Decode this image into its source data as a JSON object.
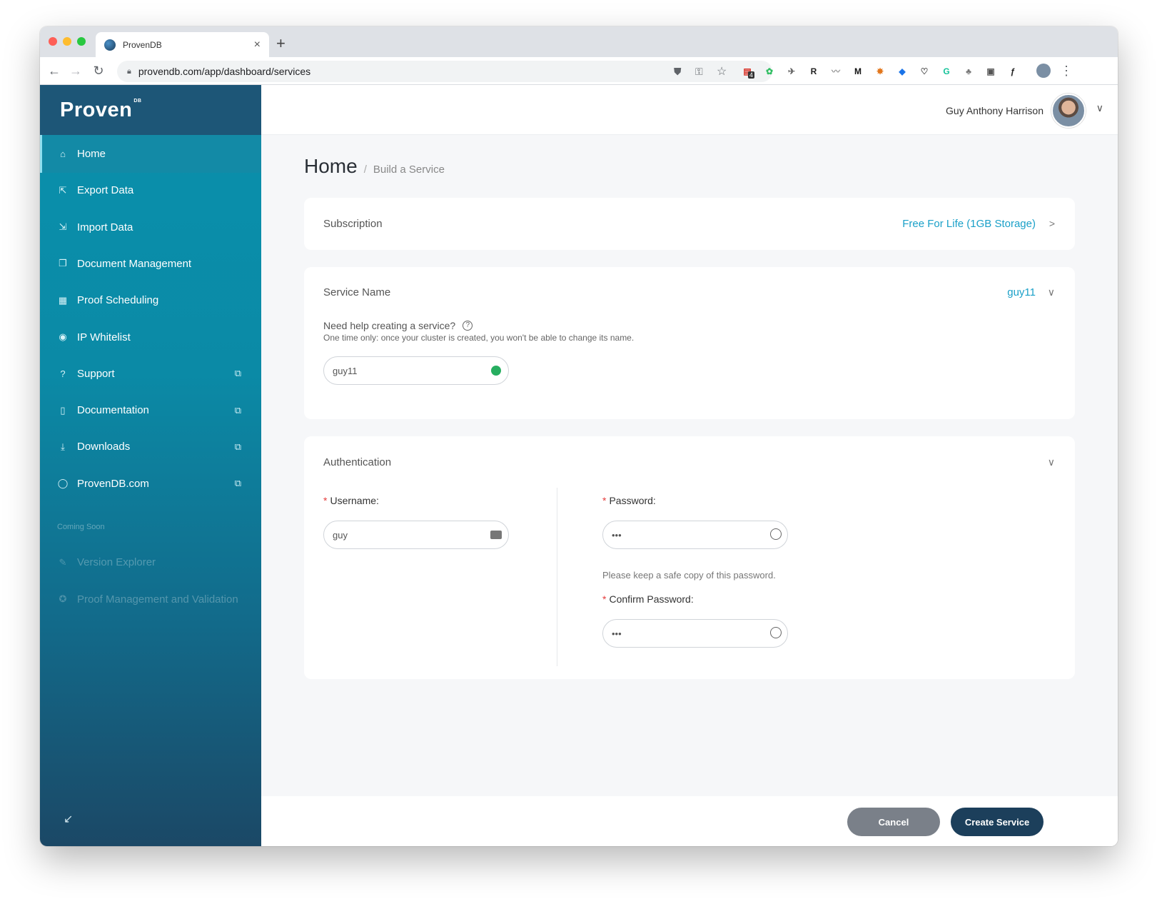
{
  "browser": {
    "tab_title": "ProvenDB",
    "tab_close": "×",
    "new_tab": "+",
    "url": "provendb.com/app/dashboard/services",
    "extensions": [
      {
        "name": "todoist-ext-icon",
        "glyph": "▤",
        "color": "#d93025",
        "badge": "4"
      },
      {
        "name": "evernote-ext-icon",
        "glyph": "✿",
        "color": "#2dbe60"
      },
      {
        "name": "send-ext-icon",
        "glyph": "✈",
        "color": "#666666"
      },
      {
        "name": "r-ext-icon",
        "glyph": "R",
        "color": "#222222"
      },
      {
        "name": "wave-ext-icon",
        "glyph": "〰",
        "color": "#999999"
      },
      {
        "name": "medium-ext-icon",
        "glyph": "M",
        "color": "#111111"
      },
      {
        "name": "metamask-ext-icon",
        "glyph": "✸",
        "color": "#e2761b"
      },
      {
        "name": "bookmark-ext-icon",
        "glyph": "◆",
        "color": "#1a73e8"
      },
      {
        "name": "pocket-ext-icon",
        "glyph": "♡",
        "color": "#444444"
      },
      {
        "name": "grammarly-ext-icon",
        "glyph": "G",
        "color": "#15c39a"
      },
      {
        "name": "tree-ext-icon",
        "glyph": "♣",
        "color": "#777777"
      },
      {
        "name": "photo-ext-icon",
        "glyph": "▣",
        "color": "#555555"
      },
      {
        "name": "script-ext-icon",
        "glyph": "ƒ",
        "color": "#222222"
      }
    ]
  },
  "sidebar": {
    "logo": "Proven",
    "logo_sup": "DB",
    "items": [
      {
        "label": "Home",
        "icon": "⌂",
        "external": false
      },
      {
        "label": "Export Data",
        "icon": "⇱",
        "external": false
      },
      {
        "label": "Import Data",
        "icon": "⇲",
        "external": false
      },
      {
        "label": "Document Management",
        "icon": "❐",
        "external": false
      },
      {
        "label": "Proof Scheduling",
        "icon": "▦",
        "external": false
      },
      {
        "label": "IP Whitelist",
        "icon": "◉",
        "external": false
      },
      {
        "label": "Support",
        "icon": "?",
        "external": true
      },
      {
        "label": "Documentation",
        "icon": "▯",
        "external": true
      },
      {
        "label": "Downloads",
        "icon": "⤓",
        "external": true
      },
      {
        "label": "ProvenDB.com",
        "icon": "◯",
        "external": true
      }
    ],
    "external_glyph": "⧉",
    "coming_soon": "Coming Soon",
    "disabled_items": [
      {
        "label": "Version Explorer",
        "icon": "✎"
      },
      {
        "label": "Proof Management and Validation",
        "icon": "✪"
      }
    ],
    "collapse_glyph": "↙"
  },
  "header": {
    "user_name": "Guy Anthony Harrison",
    "caret": "∨"
  },
  "breadcrumb": {
    "home": "Home",
    "separator": "/",
    "current": "Build a Service"
  },
  "subscription": {
    "label": "Subscription",
    "value": "Free For Life (1GB Storage)",
    "chevron": ">"
  },
  "service_name": {
    "label": "Service Name",
    "value": "guy11",
    "chevron": "∨",
    "help_question": "Need help creating a service?",
    "help_note": "One time only: once your cluster is created, you won't be able to change its name.",
    "input_value": "guy11"
  },
  "authentication": {
    "label": "Authentication",
    "chevron": "∨",
    "username_label": "Username",
    "username_value": "guy",
    "password_label": "Password",
    "password_value": "•••",
    "password_hint": "Please keep a safe copy of this password.",
    "confirm_label": "Confirm Password",
    "confirm_value": "•••",
    "required_mark": "*",
    "colon": ":"
  },
  "footer": {
    "cancel": "Cancel",
    "create": "Create Service"
  },
  "colors": {
    "accent": "#1aa0c8",
    "primary_button": "#1c3f5b",
    "cancel_button": "#7a8089",
    "required": "#e53b3b"
  }
}
